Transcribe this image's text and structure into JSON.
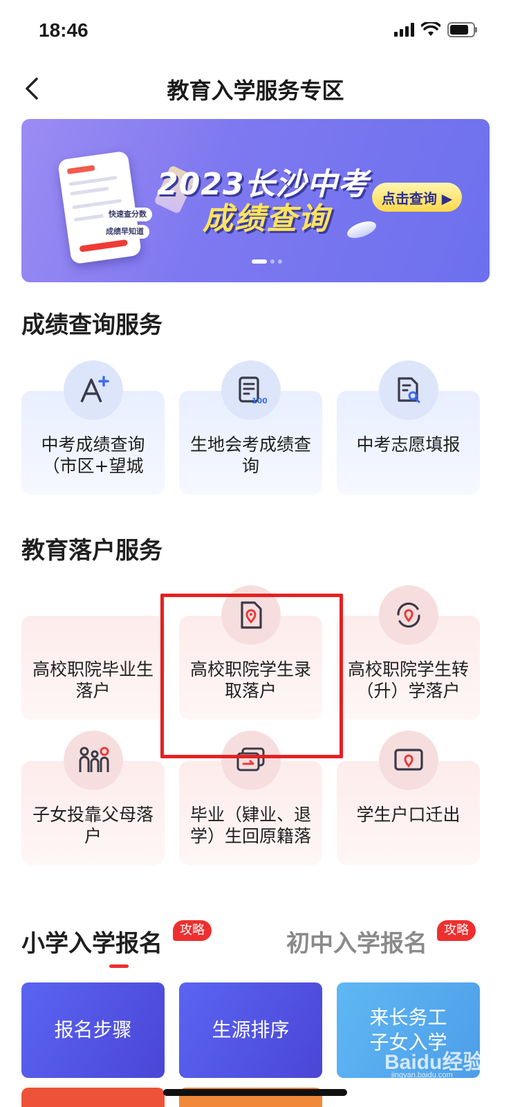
{
  "status_bar": {
    "time": "18:46"
  },
  "nav": {
    "title": "教育入学服务专区"
  },
  "banner": {
    "title_line1": "2023长沙中考",
    "title_line2": "成绩查询",
    "cta_label": "点击查询 ▶",
    "tag1": "快速查分数",
    "tag2": "成绩早知道"
  },
  "score_section": {
    "title": "成绩查询服务",
    "items": [
      {
        "label": "中考成绩查询（市区+望城",
        "icon": "grade-a-plus-icon"
      },
      {
        "label": "生地会考成绩查询",
        "icon": "score-sheet-icon"
      },
      {
        "label": "中考志愿填报",
        "icon": "document-search-icon"
      }
    ]
  },
  "hukou_section": {
    "title": "教育落户服务",
    "items": [
      {
        "label": "高校职院毕业生落户",
        "icon": "graduate-icon"
      },
      {
        "label": "高校职院学生录取落户",
        "icon": "file-location-icon"
      },
      {
        "label": "高校职院学生转（升）学落户",
        "icon": "location-transfer-icon"
      },
      {
        "label": "子女投靠父母落户",
        "icon": "family-icon"
      },
      {
        "label": "毕业（肄业、退学）生回原籍落",
        "icon": "return-card-icon"
      },
      {
        "label": "学生户口迁出",
        "icon": "screen-location-icon"
      }
    ]
  },
  "enroll_tabs": {
    "tab1": "小学入学报名",
    "tab2": "初中入学报名",
    "badge": "攻略"
  },
  "actions": [
    {
      "label": "报名步骤"
    },
    {
      "label": "生源排序"
    },
    {
      "label": "来长务工子女入学"
    }
  ],
  "watermark": {
    "text": "Baidu经验",
    "url": "jingyan.baidu.com"
  },
  "colors": {
    "accent_red": "#ee2f2f",
    "highlight_red": "#e62020",
    "banner_purple": "#7f79f0",
    "action_purple": "#5b64f2",
    "action_sky": "#5fb7f4"
  }
}
